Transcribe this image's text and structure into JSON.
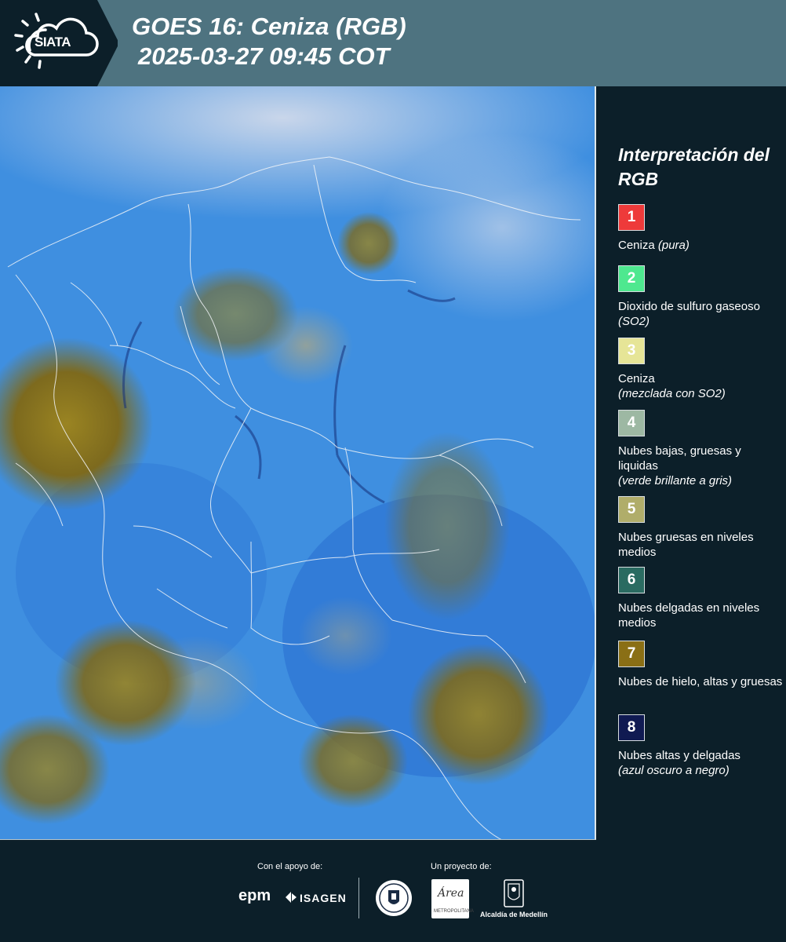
{
  "header": {
    "logo_text": "SIATA",
    "title": "GOES 16: Ceniza (RGB)",
    "subtitle": "2025-03-27 09:45 COT"
  },
  "legend": {
    "title": "Interpretación del RGB",
    "items": [
      {
        "number": "1",
        "color": "#ee3a3a",
        "label": "Ceniza",
        "note": "(pura)",
        "text_color": "#ffffff"
      },
      {
        "number": "2",
        "color": "#4ee88f",
        "label": "Dioxido de sulfuro gaseoso",
        "note": "(SO2)",
        "text_color": "#ffffff"
      },
      {
        "number": "3",
        "color": "#e6e597",
        "label": "Ceniza",
        "note": "(mezclada con SO2)",
        "text_color": "#ffffff"
      },
      {
        "number": "4",
        "color": "#9db8a3",
        "label": "Nubes bajas, gruesas y liquidas",
        "note": "(verde brillante a gris)",
        "text_color": "#ffffff"
      },
      {
        "number": "5",
        "color": "#b0ad6a",
        "label": "Nubes gruesas en niveles medios",
        "note": "",
        "text_color": "#ffffff"
      },
      {
        "number": "6",
        "color": "#2a6b61",
        "label": "Nubes delgadas en niveles medios",
        "note": "",
        "text_color": "#ffffff"
      },
      {
        "number": "7",
        "color": "#8a6f15",
        "label": "Nubes de hielo, altas y gruesas",
        "note": "",
        "text_color": "#ffffff"
      },
      {
        "number": "8",
        "color": "#101a52",
        "label": "Nubes altas y delgadas",
        "note": "(azul oscuro a negro)",
        "text_color": "#ffffff"
      }
    ]
  },
  "footer": {
    "support_label": "Con el apoyo de:",
    "project_label": "Un proyecto de:",
    "epm_text": "epm",
    "isagen_text": "ISAGEN",
    "amva_text": "Área",
    "amva_caption": "METROPOLITANA",
    "alcaldia_text": "Alcaldía de Medellín"
  }
}
